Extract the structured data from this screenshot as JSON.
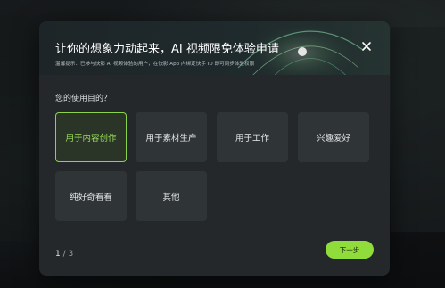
{
  "dialog": {
    "title": "让你的想象力动起来，AI 视频限免体验申请",
    "subtitle": "温馨提示：已参与快影 AI 视频体验的用户，在快影 App 内绑定快手 ID 即可同步体验权限",
    "question": "您的使用目的？",
    "options": [
      {
        "label": "用于内容创作",
        "selected": true
      },
      {
        "label": "用于素材生产",
        "selected": false
      },
      {
        "label": "用于工作",
        "selected": false
      },
      {
        "label": "兴趣爱好",
        "selected": false
      },
      {
        "label": "纯好奇看看",
        "selected": false
      },
      {
        "label": "其他",
        "selected": false
      }
    ],
    "pager": {
      "current": "1",
      "separator": "/",
      "total": "3"
    },
    "next_label": "下一步",
    "close_icon": "close-icon"
  },
  "colors": {
    "accent": "#8fdc3a",
    "selected_text": "#9be05a",
    "modal_bg": "#24282b",
    "option_bg": "#2f3437"
  }
}
